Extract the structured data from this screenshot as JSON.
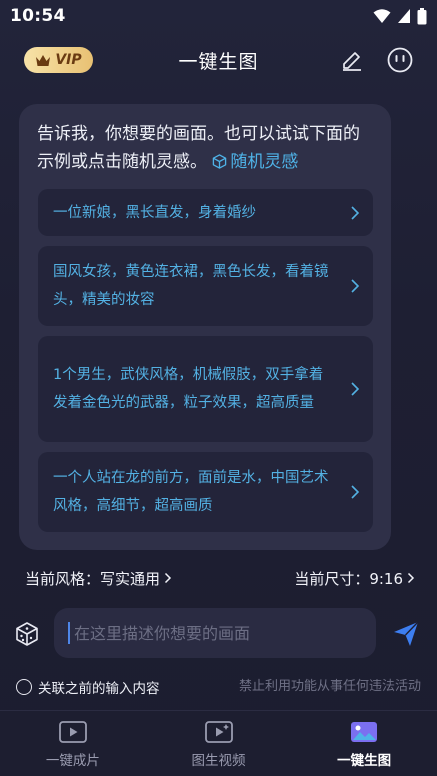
{
  "status_bar": {
    "time": "10:54"
  },
  "header": {
    "vip_label": "VIP",
    "title": "一键生图"
  },
  "chat": {
    "intro": "告诉我，你想要的画面。也可以试试下面的示例或点击随机灵感。",
    "random_label": "随机灵感",
    "examples": [
      {
        "text": "一位新娘，黑长直发，身着婚纱"
      },
      {
        "text": "国风女孩，黄色连衣裙，黑色长发，看着镜头，精美的妆容"
      },
      {
        "text": "1个男生，武侠风格，机械假肢，双手拿着发着金色光的武器，粒子效果，超高质量"
      },
      {
        "text": "一个人站在龙的前方，面前是水，中国艺术风格，高细节，超高画质"
      }
    ]
  },
  "settings": {
    "style_label": "当前风格：写实通用",
    "size_label": "当前尺寸：9:16"
  },
  "composer": {
    "placeholder": "在这里描述你想要的画面",
    "value": ""
  },
  "options": {
    "associate_label": "关联之前的输入内容",
    "disclaimer": "禁止利用功能从事任何违法活动"
  },
  "tabbar": {
    "tabs": [
      {
        "label": "一键成片",
        "active": false
      },
      {
        "label": "图生视频",
        "active": false
      },
      {
        "label": "一键生图",
        "active": true
      }
    ]
  },
  "colors": {
    "accent": "#53b1e3",
    "send": "#3d7ef0",
    "vip_gold": "#e8c173",
    "background": "#1e1f33",
    "bubble": "#2f3048"
  }
}
